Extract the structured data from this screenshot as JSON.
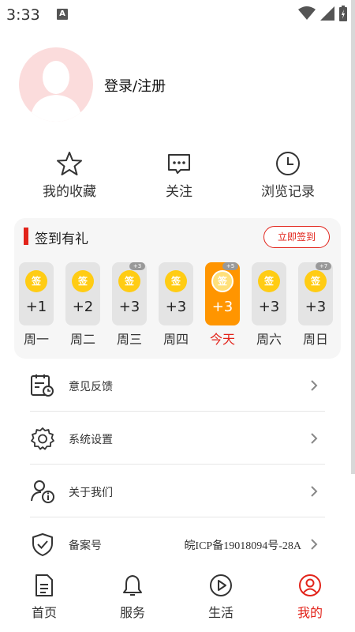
{
  "status_bar": {
    "time": "3:33",
    "notification_badge": "A"
  },
  "profile": {
    "login_text": "登录/注册"
  },
  "quick_actions": [
    {
      "label": "我的收藏",
      "icon": "star-icon"
    },
    {
      "label": "关注",
      "icon": "chat-icon"
    },
    {
      "label": "浏览记录",
      "icon": "clock-icon"
    }
  ],
  "signin": {
    "title": "签到有礼",
    "button": "立即签到",
    "coin_text": "签",
    "days": [
      {
        "points": "+1",
        "label": "周一",
        "bonus": ""
      },
      {
        "points": "+2",
        "label": "周二",
        "bonus": ""
      },
      {
        "points": "+3",
        "label": "周三",
        "bonus": "+3"
      },
      {
        "points": "+3",
        "label": "周四",
        "bonus": ""
      },
      {
        "points": "+3",
        "label": "今天",
        "bonus": "+5"
      },
      {
        "points": "+3",
        "label": "周六",
        "bonus": ""
      },
      {
        "points": "+3",
        "label": "周日",
        "bonus": "+7"
      }
    ]
  },
  "menu": [
    {
      "label": "意见反馈",
      "value": "",
      "icon": "feedback-calendar-icon"
    },
    {
      "label": "系统设置",
      "value": "",
      "icon": "gear-icon"
    },
    {
      "label": "关于我们",
      "value": "",
      "icon": "user-info-icon"
    },
    {
      "label": "备案号",
      "value": "皖ICP备19018094号-28A",
      "icon": "shield-check-icon"
    }
  ],
  "bottom_nav": [
    {
      "label": "首页",
      "icon": "document-icon"
    },
    {
      "label": "服务",
      "icon": "bell-icon"
    },
    {
      "label": "生活",
      "icon": "play-icon"
    },
    {
      "label": "我的",
      "icon": "user-circle-icon"
    }
  ],
  "colors": {
    "accent": "#e2231a",
    "today": "#ff9500",
    "coin": "#ffcc14",
    "card_bg": "#f6f6f6"
  }
}
